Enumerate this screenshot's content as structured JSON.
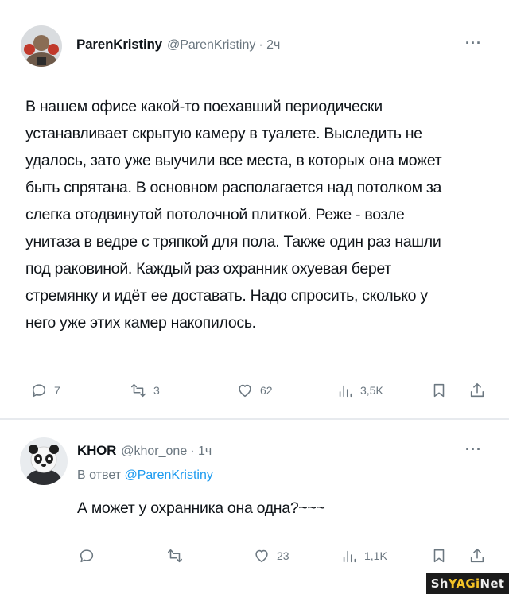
{
  "tweet": {
    "author_name": "ParenKristiny",
    "author_handle": "@ParenKristiny",
    "time": "· 2ч",
    "more": "···",
    "lines": [
      "В нашем офисе какой-то поехавший периодически",
      "устанавливает скрытую камеру в туалете. Выследить не",
      "удалось, зато уже выучили все места, в которых она может",
      "быть спрятана. В основном располагается над потолком за",
      "слегка отодвинутой потолочной плиткой. Реже - возле",
      "унитаза в ведре с тряпкой для пола. Также один раз нашли",
      "под раковиной. Каждый раз охранник охуевая берет",
      "стремянку и идёт ее доставать. Надо спросить, сколько у",
      "него уже этих камер накопилось."
    ],
    "actions": {
      "replies": "7",
      "retweets": "3",
      "likes": "62",
      "views": "3,5K"
    }
  },
  "reply": {
    "author_name": "KHOR",
    "author_handle": "@khor_one",
    "time": "· 1ч",
    "more": "···",
    "reply_prefix": "В ответ",
    "reply_mention": "@ParenKristiny",
    "text": "А может у охранника она одна?~~~",
    "actions": {
      "replies": "",
      "retweets": "",
      "likes": "23",
      "views": "1,1K"
    }
  },
  "watermark": {
    "part1": "Sh",
    "part2": "YAGi",
    "part3": "Net"
  },
  "icons": [
    "reply-icon",
    "retweet-icon",
    "like-icon",
    "views-icon",
    "bookmark-icon",
    "share-icon",
    "more-icon"
  ],
  "colors": {
    "text": "#0f1419",
    "muted": "#6b7780",
    "link": "#1d9bf0"
  }
}
